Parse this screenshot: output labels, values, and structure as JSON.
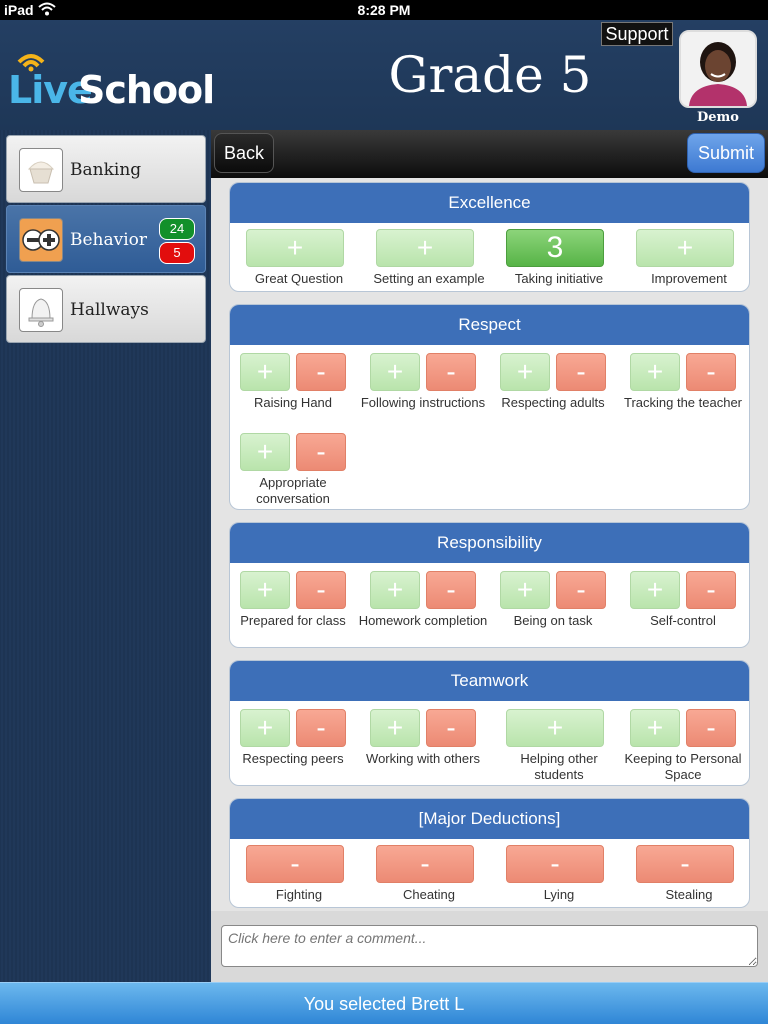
{
  "status_bar": {
    "carrier": "iPad",
    "time": "8:28 PM"
  },
  "header": {
    "logo_live": "Live",
    "logo_school": "School",
    "title": "Grade 5",
    "support_label": "Support",
    "user_name": "Demo"
  },
  "sidebar": {
    "items": [
      {
        "label": "Banking",
        "icon": "cupcake-icon"
      },
      {
        "label": "Behavior",
        "icon": "plus-minus-icon",
        "positive_count": "24",
        "negative_count": "5"
      },
      {
        "label": "Hallways",
        "icon": "bell-icon"
      }
    ]
  },
  "toolbar": {
    "back_label": "Back",
    "submit_label": "Submit"
  },
  "categories": [
    {
      "title": "Excellence",
      "behaviors": [
        {
          "label": "Great Question",
          "plus": "+"
        },
        {
          "label": "Setting an example",
          "plus": "+"
        },
        {
          "label": "Taking initiative",
          "count": "3"
        },
        {
          "label": "Improvement",
          "plus": "+"
        }
      ]
    },
    {
      "title": "Respect",
      "behaviors": [
        {
          "label": "Raising Hand",
          "plus": "+",
          "minus": "-"
        },
        {
          "label": "Following instructions",
          "plus": "+",
          "minus": "-"
        },
        {
          "label": "Respecting adults",
          "plus": "+",
          "minus": "-"
        },
        {
          "label": "Tracking the teacher",
          "plus": "+",
          "minus": "-"
        },
        {
          "label": "Appropriate conversation",
          "plus": "+",
          "minus": "-"
        }
      ]
    },
    {
      "title": "Responsibility",
      "behaviors": [
        {
          "label": "Prepared for class",
          "plus": "+",
          "minus": "-"
        },
        {
          "label": "Homework completion",
          "plus": "+",
          "minus": "-"
        },
        {
          "label": "Being on task",
          "plus": "+",
          "minus": "-"
        },
        {
          "label": "Self-control",
          "plus": "+",
          "minus": "-"
        }
      ]
    },
    {
      "title": "Teamwork",
      "behaviors": [
        {
          "label": "Respecting peers",
          "plus": "+",
          "minus": "-"
        },
        {
          "label": "Working with others",
          "plus": "+",
          "minus": "-"
        },
        {
          "label": "Helping other students",
          "plus": "+"
        },
        {
          "label": "Keeping to Personal Space",
          "plus": "+",
          "minus": "-"
        }
      ]
    },
    {
      "title": "[Major Deductions]",
      "behaviors": [
        {
          "label": "Fighting",
          "minus": "-"
        },
        {
          "label": "Cheating",
          "minus": "-"
        },
        {
          "label": "Lying",
          "minus": "-"
        },
        {
          "label": "Stealing",
          "minus": "-"
        }
      ]
    }
  ],
  "comment": {
    "placeholder": "Click here to enter a comment..."
  },
  "footer": {
    "selection_text": "You selected Brett L"
  }
}
